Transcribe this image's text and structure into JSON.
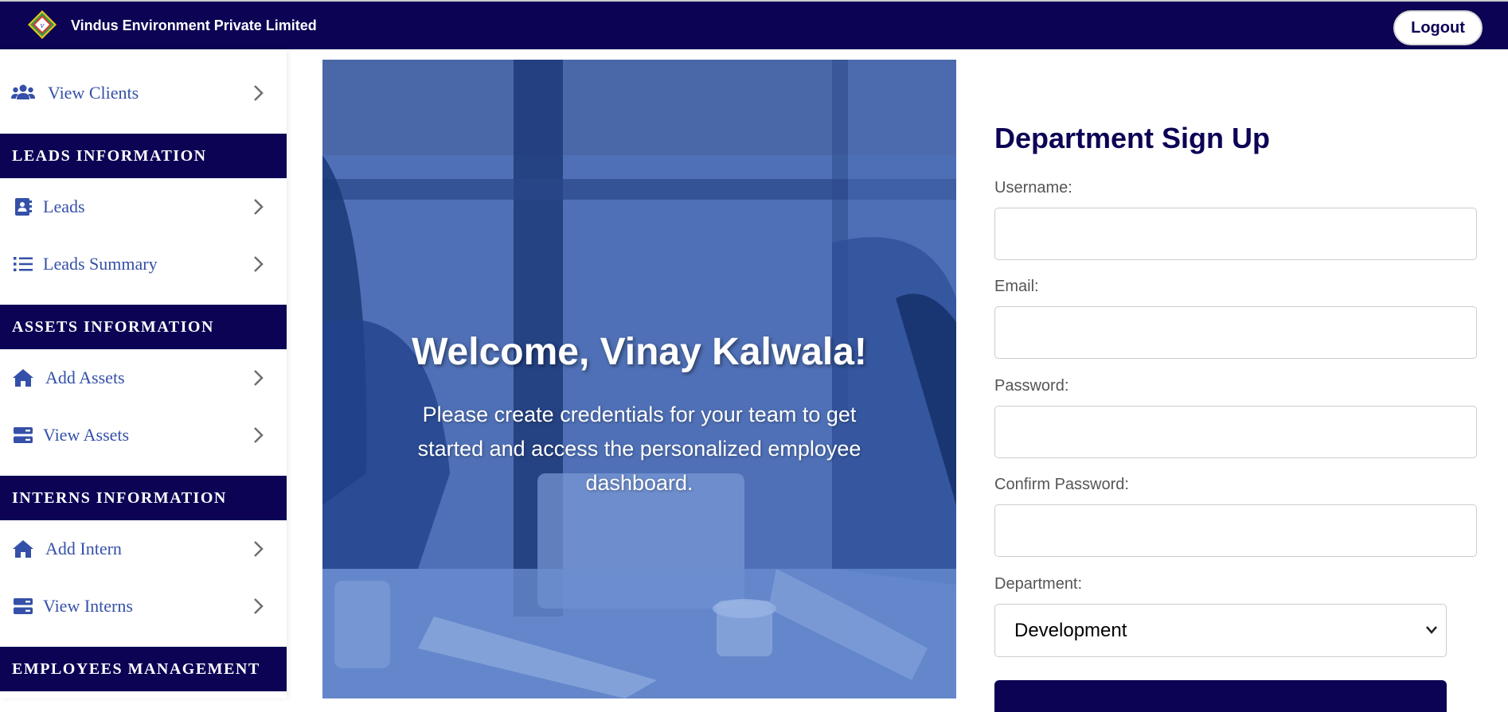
{
  "header": {
    "company_name": "Vindus Environment Private Limited",
    "logo_text": "v",
    "logout_label": "Logout",
    "bg_color": "#0c0355"
  },
  "sidebar": {
    "items": [
      {
        "label": "View Clients",
        "icon": "users-icon"
      },
      {
        "section": "LEADS INFORMATION"
      },
      {
        "label": "Leads",
        "icon": "contact-book-icon"
      },
      {
        "label": "Leads Summary",
        "icon": "list-icon"
      },
      {
        "section": "ASSETS INFORMATION"
      },
      {
        "label": "Add Assets",
        "icon": "home-icon"
      },
      {
        "label": "View Assets",
        "icon": "server-icon"
      },
      {
        "section": "INTERNS INFORMATION"
      },
      {
        "label": "Add Intern",
        "icon": "home-icon"
      },
      {
        "label": "View Interns",
        "icon": "server-icon"
      },
      {
        "section": "EMPLOYEES MANAGEMENT"
      }
    ],
    "accent_color": "#3550a8"
  },
  "hero": {
    "welcome": "Welcome, Vinay Kalwala!",
    "message": "Please create credentials for your team to get started and access the personalized employee dashboard."
  },
  "form": {
    "title": "Department Sign Up",
    "username_label": "Username:",
    "email_label": "Email:",
    "password_label": "Password:",
    "confirm_password_label": "Confirm Password:",
    "department_label": "Department:",
    "department_value": "Development",
    "title_color": "#0c0355"
  }
}
